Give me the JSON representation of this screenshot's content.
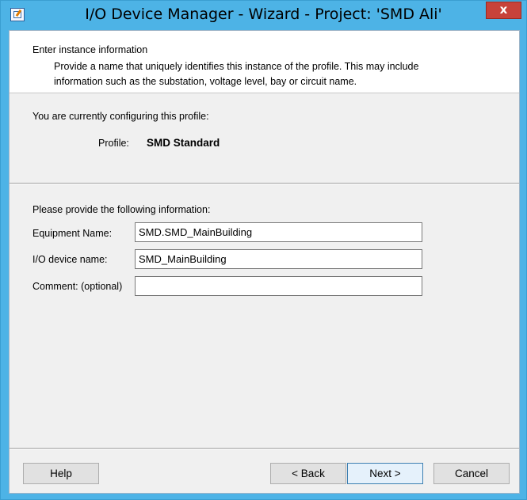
{
  "window": {
    "title": "I/O Device Manager - Wizard - Project: 'SMD Ali'",
    "close_label": "x"
  },
  "header": {
    "title": "Enter instance information",
    "description": "Provide a name that uniquely identifies this instance of the profile.  This may include information such as the substation, voltage level, bay or circuit name."
  },
  "profile_section": {
    "intro": "You are currently configuring this profile:",
    "profile_label": "Profile:",
    "profile_value": "SMD Standard"
  },
  "form": {
    "intro": "Please provide the following information:",
    "equipment_label": "Equipment Name:",
    "equipment_value": "SMD.SMD_MainBuilding",
    "io_device_label": "I/O device name:",
    "io_device_value": "SMD_MainBuilding",
    "comment_label": "Comment: (optional)",
    "comment_value": ""
  },
  "buttons": {
    "help": "Help",
    "back": "< Back",
    "next": "Next >",
    "cancel": "Cancel"
  }
}
